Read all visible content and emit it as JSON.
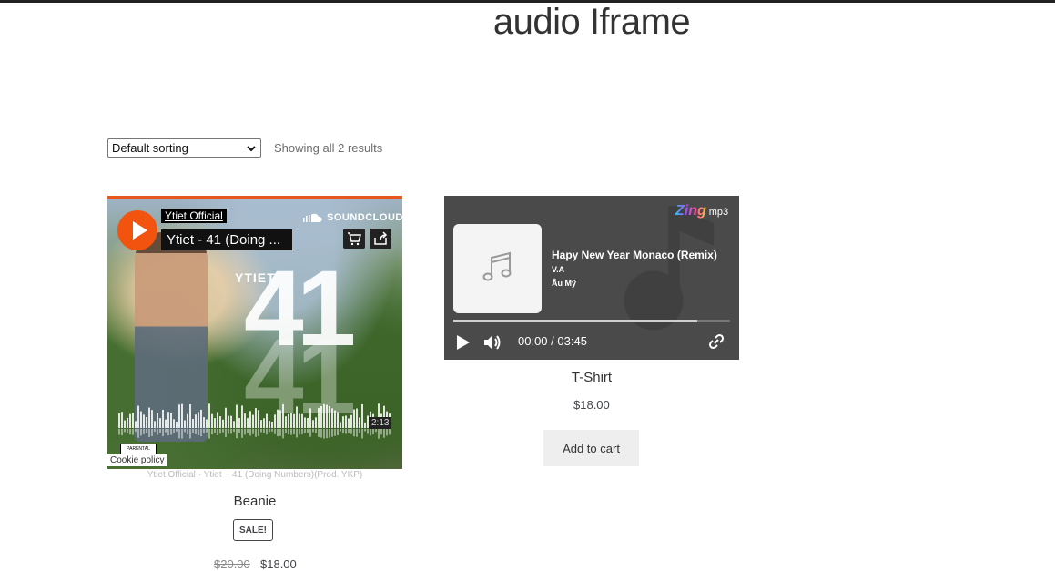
{
  "page": {
    "title": "audio Iframe"
  },
  "toolbar": {
    "sort_value": "Default sorting",
    "result_count": "Showing all 2 results"
  },
  "products": [
    {
      "name": "Beanie",
      "badge": "SALE!",
      "price_old": "$20.00",
      "price_new": "$18.00",
      "embed": {
        "provider": "SOUNDCLOUD",
        "user": "Ytiet Official",
        "track": "Ytiet - 41 (Doing ...",
        "duration": "2:13",
        "cookie": "Cookie policy",
        "art_label": "YTIET",
        "art_number": "41",
        "caption_user": "Ytiet Official",
        "caption_sep": "·",
        "caption_track": "Ytiet ~ 41 (Doing Numbers)(Prod. YKP)",
        "accent": "#f2530e"
      }
    },
    {
      "name": "T-Shirt",
      "price": "$18.00",
      "button": "Add to cart",
      "embed": {
        "brand": "Zing",
        "brand_suffix": "mp3",
        "song": "Hapy New Year Monaco (Remix)",
        "artist": "V.A",
        "genre": "Âu Mỹ",
        "current_time": "00:00",
        "separator": "/",
        "total_time": "03:45",
        "progress": 0.88
      }
    }
  ]
}
